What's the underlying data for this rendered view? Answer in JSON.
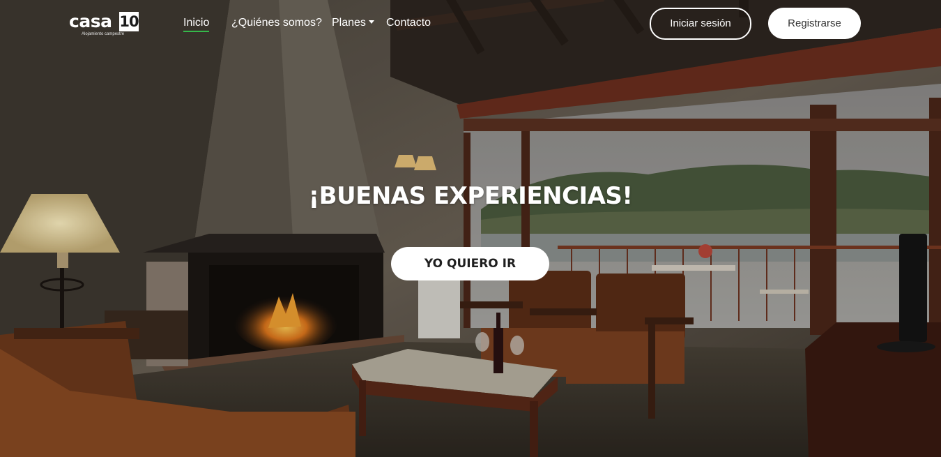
{
  "brand": {
    "logo_word": "casa",
    "logo_number": "10",
    "logo_tagline": "Alojamiento campestre"
  },
  "nav": {
    "items": [
      {
        "label": "Inicio",
        "active": true
      },
      {
        "label": "¿Quiénes somos?"
      },
      {
        "label": "Planes",
        "has_dropdown": true
      },
      {
        "label": "Contacto"
      }
    ],
    "login_label": "Iniciar sesión",
    "register_label": "Registrarse"
  },
  "hero": {
    "title": "¡BUENAS EXPERIENCIAS!",
    "cta_label": "YO QUIERO IR",
    "background_icon": "living-room-photo"
  },
  "colors": {
    "active_underline": "#35b84a",
    "button_bg": "#ffffff"
  }
}
